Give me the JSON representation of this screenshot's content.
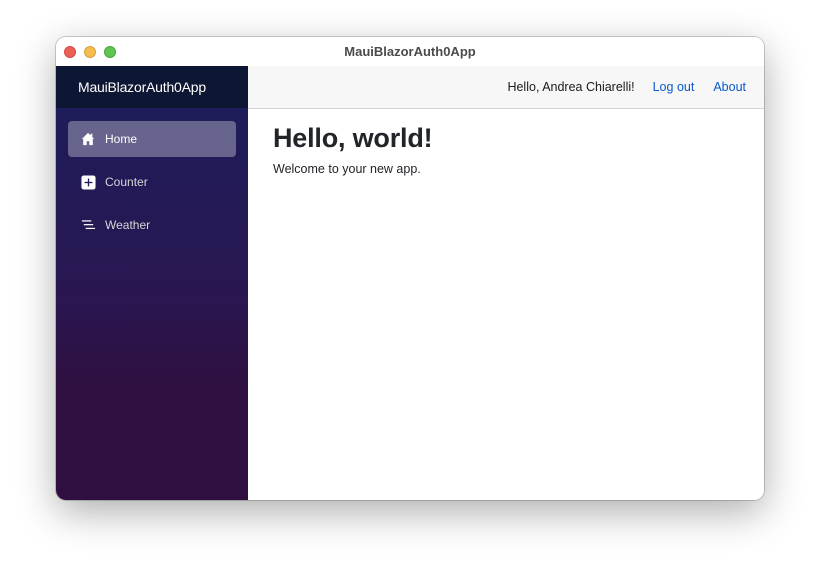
{
  "window": {
    "title": "MauiBlazorAuth0App",
    "controls": [
      "close",
      "minimize",
      "maximize"
    ]
  },
  "sidebar": {
    "brand": "MauiBlazorAuth0App",
    "items": [
      {
        "label": "Home",
        "icon": "house-icon",
        "active": true
      },
      {
        "label": "Counter",
        "icon": "plus-square-icon",
        "active": false
      },
      {
        "label": "Weather",
        "icon": "list-nested-icon",
        "active": false
      }
    ]
  },
  "topbar": {
    "greeting": "Hello, Andrea Chiarelli!",
    "logout_label": "Log out",
    "about_label": "About"
  },
  "page": {
    "heading": "Hello, world!",
    "body": "Welcome to your new app."
  },
  "colors": {
    "link": "#0a58ca",
    "sidebar_top": "#0d1633",
    "sidebar_gradient_start": "#1b1e5c",
    "sidebar_gradient_end": "#2f0f3f"
  }
}
